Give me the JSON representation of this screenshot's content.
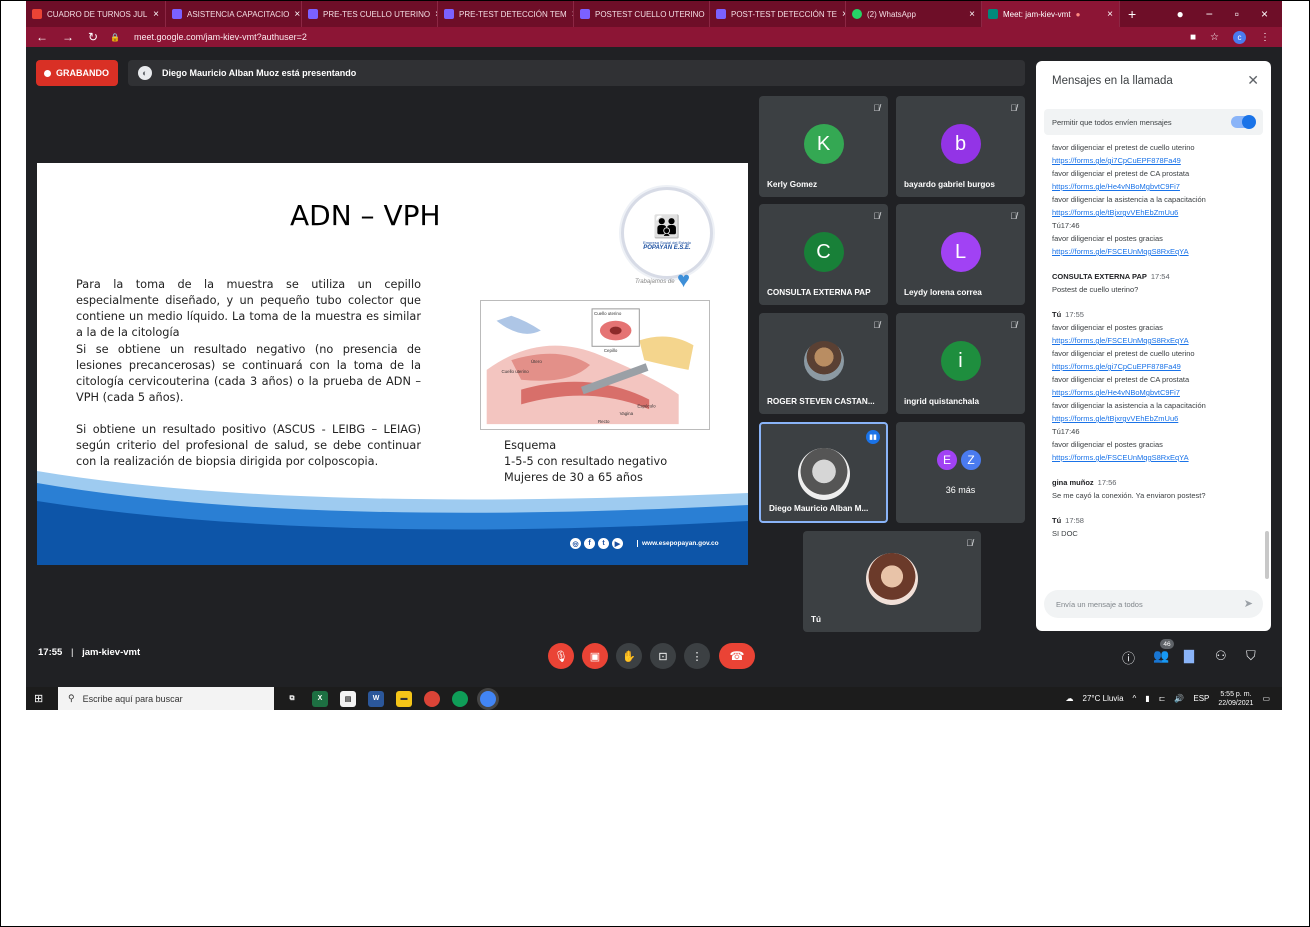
{
  "tabs": [
    {
      "label": "CUADRO DE TURNOS JUL",
      "color": "#ea4335"
    },
    {
      "label": "ASISTENCIA CAPACITACIO",
      "color": "#7b61ff"
    },
    {
      "label": "PRE-TES CUELLO UTERINO",
      "color": "#7b61ff"
    },
    {
      "label": "PRE-TEST DETECCIÓN TEM",
      "color": "#7b61ff"
    },
    {
      "label": "POSTEST CUELLO UTERINO",
      "color": "#7b61ff"
    },
    {
      "label": "POST-TEST DETECCIÓN TE",
      "color": "#7b61ff"
    },
    {
      "label": "(2) WhatsApp",
      "color": "#25d366"
    },
    {
      "label": "Meet: jam-kiev-vmt",
      "color": "#00897b"
    }
  ],
  "url": "meet.google.com/jam-kiev-vmt?authuser=2",
  "profile_initial": "c",
  "recording_label": "GRABANDO",
  "presenting_text": "Diego Mauricio Alban Muoz está presentando",
  "slide": {
    "title": "ADN – VPH",
    "p1": "Para la toma de la muestra se utiliza un cepillo especialmente diseñado, y un pequeño tubo colector que contiene un medio líquido. La toma de la muestra es similar a la de la citología",
    "p2": "Si se obtiene un resultado negativo (no presencia de lesiones precancerosas) se continuará con la toma de la citología cervicouterina (cada 3 años) o la prueba de ADN –VPH (cada 5 años).",
    "p3": "Si obtiene un resultado positivo (ASCUS - LEIBG – LEIAG) según criterio del profesional de salud, se debe continuar con la realización de biopsia dirigida por colposcopia.",
    "esquema_l1": "Esquema",
    "esquema_l2": "1-5-5 con resultado negativo",
    "esquema_l3": "Mujeres de 30 a 65 años",
    "logo_line1": "Empresa Social del Estado",
    "logo_line2": "POPAYÁN E.S.E.",
    "logo_tag": "Trabajamos de",
    "diagram_labels": [
      "Cuello uterino",
      "Cepillo",
      "Útero",
      "Cuello uterino",
      "Espéculo",
      "Vagina",
      "Recto"
    ],
    "website": "www.esepopayan.gov.co"
  },
  "participants": [
    {
      "initial": "K",
      "name": "Kerly Gomez",
      "color": "#34a853"
    },
    {
      "initial": "b",
      "name": "bayardo gabriel burgos",
      "color": "#9334e6"
    },
    {
      "initial": "C",
      "name": "CONSULTA EXTERNA PAP",
      "color": "#188038"
    },
    {
      "initial": "L",
      "name": "Leydy lorena correa",
      "color": "#a142f4"
    },
    {
      "initial": "",
      "name": "ROGER STEVEN CASTAN...",
      "color": ""
    },
    {
      "initial": "i",
      "name": "ingrid quistanchala",
      "color": "#1e8e3e"
    },
    {
      "initial": "",
      "name": "Diego Mauricio Alban M...",
      "color": ""
    },
    {
      "initial": "",
      "name": "Tú",
      "color": ""
    }
  ],
  "more": {
    "a1": "E",
    "a2": "Z",
    "label": "36 más"
  },
  "chat": {
    "title": "Mensajes en la llamada",
    "permit": "Permitir que todos envíen mensajes",
    "input_placeholder": "Envía un mensaje a todos",
    "m1": "favor diligenciar el pretest de cuello uterino",
    "l1": "https://forms.gle/gi7CpCuEPF878Fa49",
    "m2": "favor diligenciar el pretest de CA prostata",
    "l2": "https://forms.gle/He4vNBoMgbvtC9Fi7",
    "m3": "favor diligenciar la asistencia a la capacitación",
    "l3": "https://forms.gle/tBjxrgvVEhEbZmUu6",
    "m4": "Tú17:46",
    "m5": "favor diligenciar el postes gracias",
    "l4": "https://forms.gle/FSCEUnMqgS8RxEqYA",
    "s1": "CONSULTA EXTERNA PAP",
    "s1t": "17:54",
    "m6": "Postest de cuello uterino?",
    "s2": "Tú",
    "s2t": "17:55",
    "m7": "favor diligenciar el postes gracias",
    "l5": "https://forms.gle/FSCEUnMqgS8RxEqYA",
    "m8": "favor diligenciar el pretest de cuello uterino",
    "l6": "https://forms.gle/gi7CpCuEPF878Fa49",
    "m9": "favor diligenciar el pretest de CA prostata",
    "l7": "https://forms.gle/He4vNBoMgbvtC9Fi7",
    "m10": "favor diligenciar la asistencia a la capacitación",
    "l8": "https://forms.gle/tBjxrgvVEhEbZmUu6",
    "m11": "Tú17:46",
    "m12": "favor diligenciar el postes gracias",
    "l9": "https://forms.gle/FSCEUnMqgS8RxEqYA",
    "s3": "gina muñoz",
    "s3t": "17:56",
    "m13": "Se me cayó la conexión. Ya enviaron postest?",
    "s4": "Tú",
    "s4t": "17:58",
    "m14": "SI DOC"
  },
  "meeting": {
    "time": "17:55",
    "code": "jam-kiev-vmt",
    "people_count": "46"
  },
  "taskbar": {
    "search": "Escribe aquí para buscar",
    "weather": "27°C Lluvia",
    "lang": "ESP",
    "time": "5:55 p. m.",
    "date": "22/09/2021"
  }
}
